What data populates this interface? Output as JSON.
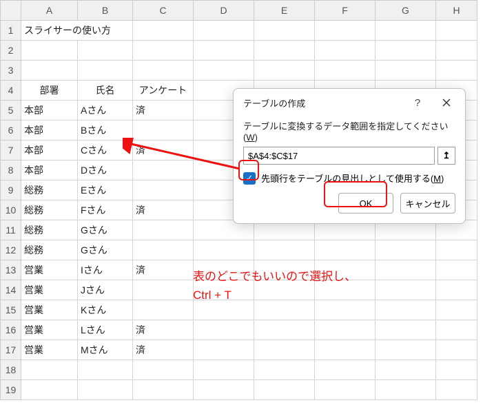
{
  "columns": [
    "A",
    "B",
    "C",
    "D",
    "E",
    "F",
    "G",
    "H"
  ],
  "row_headers": [
    "1",
    "2",
    "3",
    "4",
    "5",
    "6",
    "7",
    "8",
    "9",
    "10",
    "11",
    "12",
    "13",
    "14",
    "15",
    "16",
    "17",
    "18",
    "19"
  ],
  "cells": {
    "A1": "スライサーの使い方",
    "A4": "部署",
    "B4": "氏名",
    "C4": "アンケート",
    "A5": "本部",
    "B5": "Aさん",
    "C5": "済",
    "A6": "本部",
    "B6": "Bさん",
    "A7": "本部",
    "B7": "Cさん",
    "C7": "済",
    "A8": "本部",
    "B8": "Dさん",
    "A9": "総務",
    "B9": "Eさん",
    "A10": "総務",
    "B10": "Fさん",
    "C10": "済",
    "A11": "総務",
    "B11": "Gさん",
    "A12": "総務",
    "B12": "Gさん",
    "A13": "営業",
    "B13": "Iさん",
    "C13": "済",
    "A14": "営業",
    "B14": "Jさん",
    "A15": "営業",
    "B15": "Kさん",
    "A16": "営業",
    "B16": "Lさん",
    "C16": "済",
    "A17": "営業",
    "B17": "Mさん",
    "C17": "済"
  },
  "dialog": {
    "title": "テーブルの作成",
    "help": "?",
    "label_pre": "テーブルに変換するデータ範囲を指定してください(",
    "label_u": "W",
    "label_post": ")",
    "range_value": "$A$4:$C$17",
    "range_btn": "↥",
    "checkbox_pre": "先頭行をテーブルの見出しとして使用する(",
    "checkbox_u": "M",
    "checkbox_post": ")",
    "ok": "OK",
    "cancel": "キャンセル"
  },
  "annotation": {
    "line1": "表のどこでもいいので選択し、",
    "line2": "Ctrl + T"
  }
}
